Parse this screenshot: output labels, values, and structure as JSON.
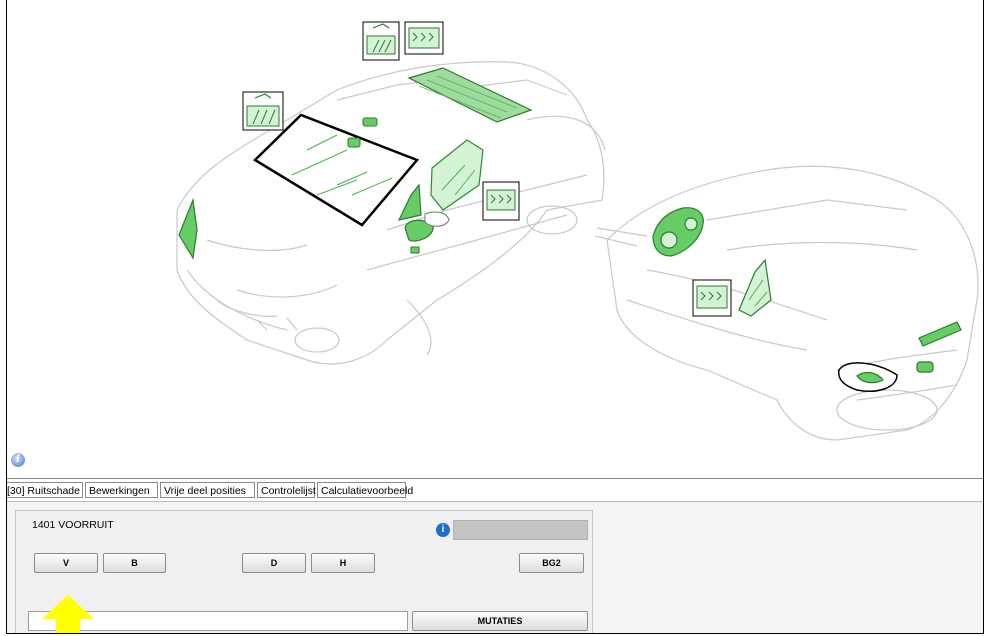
{
  "tabs": [
    {
      "label": "[30] Ruitschade"
    },
    {
      "label": "Bewerkingen"
    },
    {
      "label": "Vrije deel posities"
    },
    {
      "label": "Controlelijst"
    },
    {
      "label": "Calculatievoorbeeld"
    }
  ],
  "panel": {
    "title": "1401 VOORRUIT",
    "buttons": {
      "v": "V",
      "b": "B",
      "d": "D",
      "h": "H",
      "bg2": "BG2",
      "mutaties": "MUTATIES"
    }
  },
  "colors": {
    "highlight_green": "#33cc33",
    "arrow_yellow": "#ffff00",
    "info_blue": "#1e6fd0"
  },
  "icons": [
    "info-icon",
    "windshield-wiper-icon",
    "heated-glass-icon",
    "arrow-up-icon"
  ]
}
